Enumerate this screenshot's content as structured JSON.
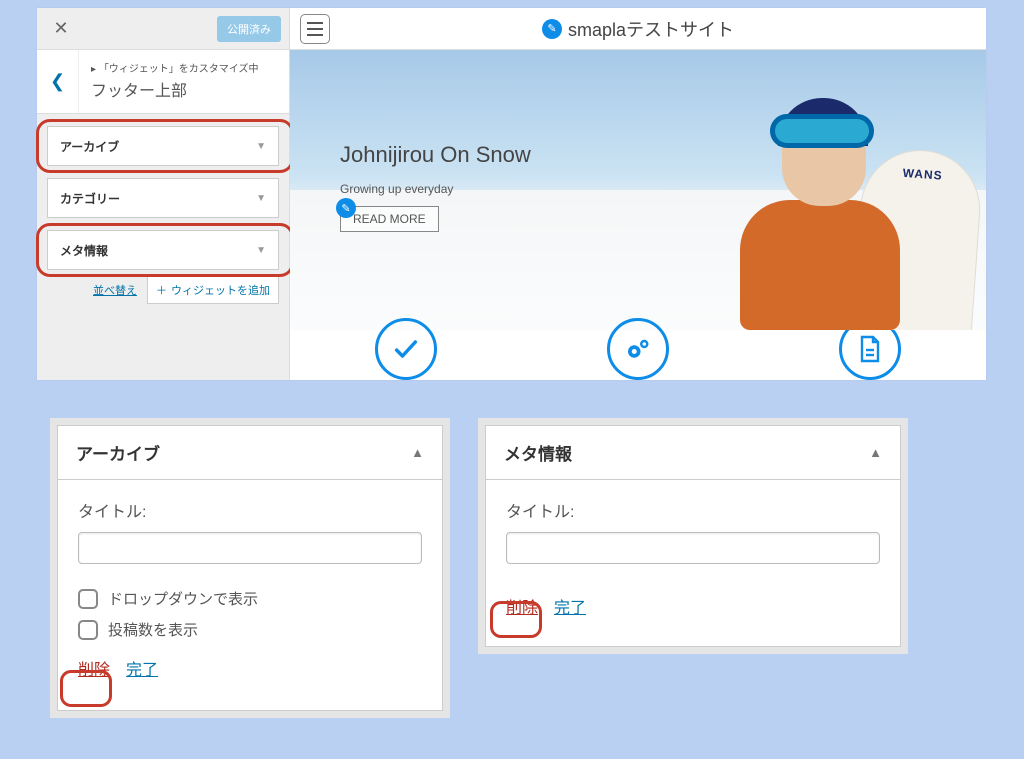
{
  "customizer": {
    "publish_label": "公開済み",
    "breadcrumb": "「ウィジェット」をカスタマイズ中",
    "section_title": "フッター上部",
    "widgets": [
      "アーカイブ",
      "カテゴリー",
      "メタ情報"
    ],
    "reorder": "並べ替え",
    "add_widget": "ウィジェットを追加"
  },
  "preview": {
    "site_name": "smaplaテストサイト",
    "hero_title": "Johnijirou On Snow",
    "hero_sub": "Growing up everyday",
    "readmore": "READ MORE"
  },
  "panel_a": {
    "title": "アーカイブ",
    "field_label": "タイトル:",
    "chk1": "ドロップダウンで表示",
    "chk2": "投稿数を表示",
    "delete": "削除",
    "done": "完了"
  },
  "panel_b": {
    "title": "メタ情報",
    "field_label": "タイトル:",
    "delete": "削除",
    "done": "完了"
  }
}
